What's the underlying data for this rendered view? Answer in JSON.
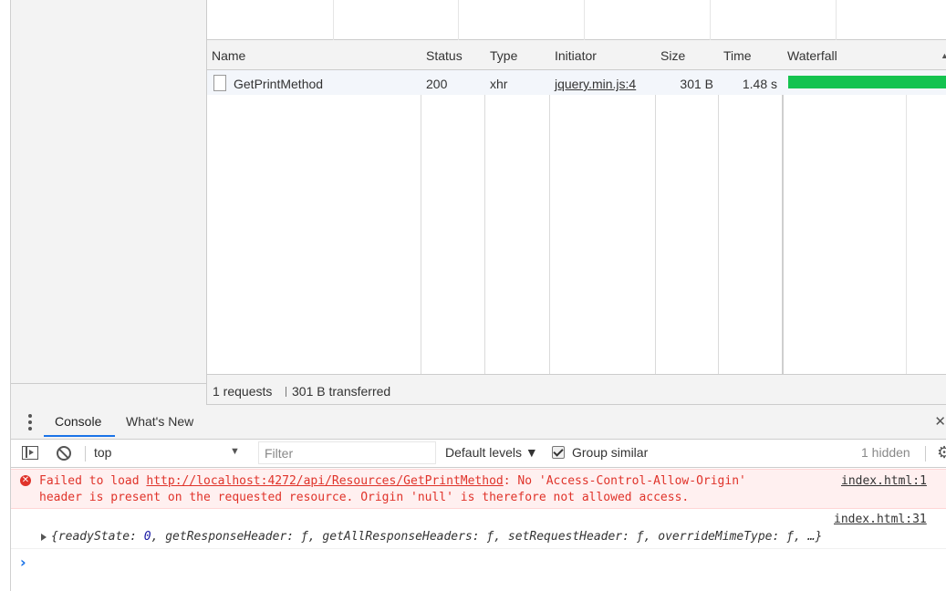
{
  "network": {
    "columns": [
      "Name",
      "Status",
      "Type",
      "Initiator",
      "Size",
      "Time",
      "Waterfall"
    ],
    "rows": [
      {
        "name": "GetPrintMethod",
        "status": "200",
        "type": "xhr",
        "initiator": "jquery.min.js:4",
        "size": "301 B",
        "time": "1.48 s"
      }
    ],
    "waterfall_bar_color": "#14c350",
    "summary": {
      "requests": "1 requests",
      "transferred": "301 B transferred"
    }
  },
  "drawer": {
    "tabs": [
      "Console",
      "What's New"
    ],
    "active_tab": "Console",
    "close_glyph": "✕"
  },
  "console_toolbar": {
    "context": "top",
    "filter_placeholder": "Filter",
    "levels": "Default levels ▼",
    "group_similar": "Group similar",
    "group_similar_checked": true,
    "hidden": "1 hidden",
    "gear_glyph": "⚙"
  },
  "console": {
    "error": {
      "prefix": "Failed to load ",
      "url": "http://localhost:4272/api/Resources/GetPrintMethod",
      "rest_line1": ": No 'Access-Control-Allow-Origin'",
      "line2": "header is present on the requested resource. Origin 'null' is therefore not allowed access.",
      "source": "index.html:1",
      "color": "#e0332a"
    },
    "log": {
      "source": "index.html:31",
      "obj_open": "{readyState: ",
      "obj_num": "0",
      "obj_rest": ", getResponseHeader: ƒ, getAllResponseHeaders: ƒ, setRequestHeader: ƒ, overrideMimeType: ƒ, …}"
    },
    "prompt_glyph": "›"
  }
}
